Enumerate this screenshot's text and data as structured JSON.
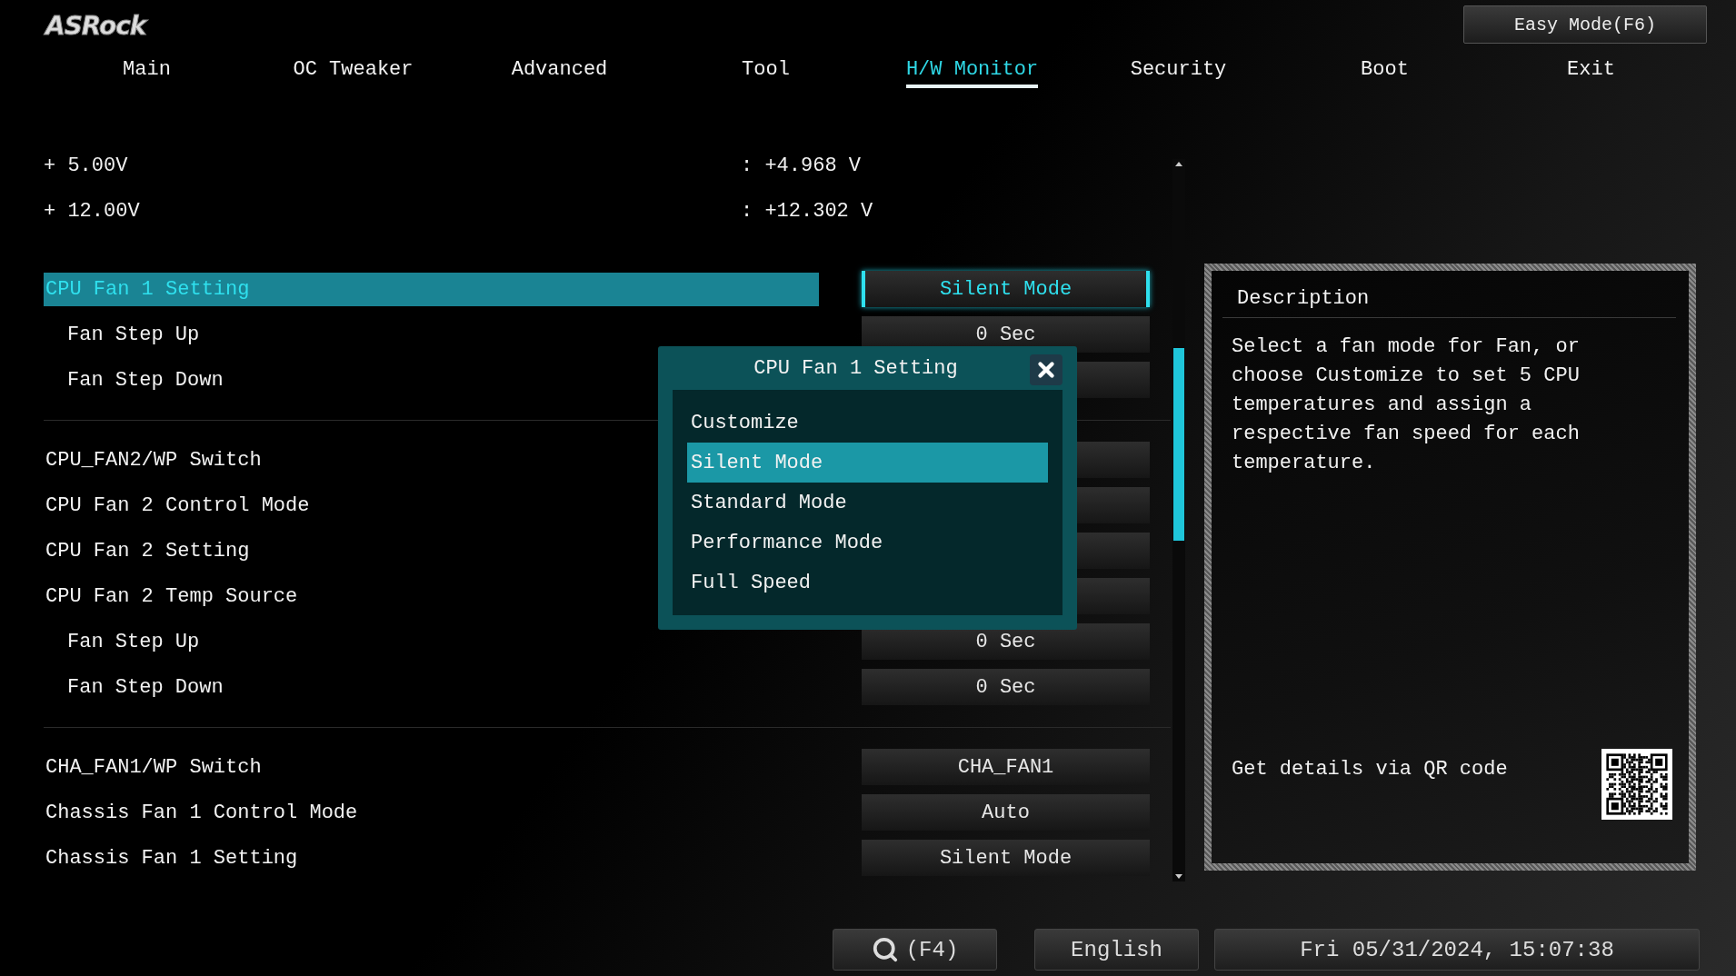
{
  "logo": "ASRock",
  "easy_mode_button": "Easy Mode(F6)",
  "tabs": [
    {
      "label": "Main",
      "selected": false
    },
    {
      "label": "OC Tweaker",
      "selected": false
    },
    {
      "label": "Advanced",
      "selected": false
    },
    {
      "label": "Tool",
      "selected": false
    },
    {
      "label": "H/W Monitor",
      "selected": true
    },
    {
      "label": "Security",
      "selected": false
    },
    {
      "label": "Boot",
      "selected": false
    },
    {
      "label": "Exit",
      "selected": false
    }
  ],
  "voltages": [
    {
      "label": "+ 5.00V",
      "value": ": +4.968 V"
    },
    {
      "label": "+ 12.00V",
      "value": ": +12.302 V"
    }
  ],
  "groups": [
    {
      "items": [
        {
          "label": "CPU Fan 1 Setting",
          "value": "Silent Mode",
          "selected": true,
          "children": [
            {
              "label": "Fan Step Up",
              "value": "0 Sec",
              "selected": false
            },
            {
              "label": "Fan Step Down",
              "selected": false
            }
          ]
        }
      ]
    },
    {
      "items": [
        {
          "label": "CPU_FAN2/WP Switch",
          "selected": false
        },
        {
          "label": "CPU Fan 2 Control Mode",
          "selected": false
        },
        {
          "label": "CPU Fan 2 Setting",
          "selected": false
        },
        {
          "label": "CPU Fan 2 Temp Source",
          "selected": false,
          "children": [
            {
              "label": "Fan Step Up",
              "value": "0 Sec",
              "selected": false
            },
            {
              "label": "Fan Step Down",
              "value": "0 Sec",
              "selected": false
            }
          ]
        }
      ]
    },
    {
      "items": [
        {
          "label": "CHA_FAN1/WP Switch",
          "value": "CHA_FAN1",
          "selected": false
        },
        {
          "label": "Chassis Fan 1 Control Mode",
          "value": "Auto",
          "selected": false
        },
        {
          "label": "Chassis Fan 1 Setting",
          "value": "Silent Mode",
          "selected": false
        }
      ]
    }
  ],
  "popup": {
    "title": "CPU Fan 1 Setting",
    "options": [
      {
        "label": "Customize",
        "selected": false
      },
      {
        "label": "Silent Mode",
        "selected": true
      },
      {
        "label": "Standard Mode",
        "selected": false
      },
      {
        "label": "Performance Mode",
        "selected": false
      },
      {
        "label": "Full Speed",
        "selected": false
      }
    ]
  },
  "description": {
    "title": "Description",
    "text": "Select a fan mode for Fan, or choose Customize to set 5 CPU temperatures and assign a respective fan speed for each temperature.",
    "qr_label": "Get details via QR code"
  },
  "footer": {
    "search_key": "(F4)",
    "language": "English",
    "datetime": "Fri 05/31/2024, 15:07:38"
  }
}
